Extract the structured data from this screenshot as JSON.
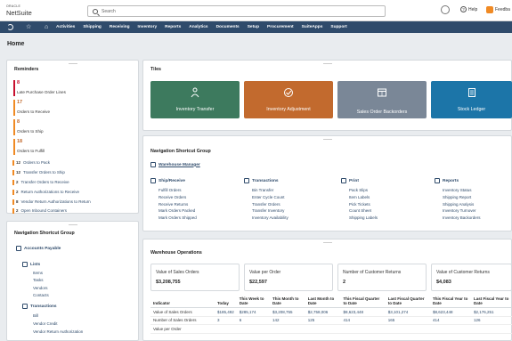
{
  "brand": {
    "oracle": "ORACLE",
    "netsuite": "NetSuite"
  },
  "search": {
    "placeholder": "Search"
  },
  "header": {
    "help": "Help",
    "user": "Feedba"
  },
  "nav": [
    "Activities",
    "Shipping",
    "Receiving",
    "Inventory",
    "Reports",
    "Analytics",
    "Documents",
    "Setup",
    "Procurement",
    "SuiteApps",
    "Support"
  ],
  "page_title": "Home",
  "reminders": {
    "title": "Reminders",
    "counts": [
      {
        "n": "8",
        "label": "Late Purchase Order Lines"
      },
      {
        "n": "17",
        "label": "Orders to Receive"
      },
      {
        "n": "8",
        "label": "Orders to Ship"
      },
      {
        "n": "18",
        "label": "Orders to Fulfill"
      }
    ],
    "small": [
      {
        "n": "12",
        "label": "Orders to Pack"
      },
      {
        "n": "12",
        "label": "Transfer Orders to Ship"
      },
      {
        "n": "2",
        "label": "Transfer Orders to Receive"
      },
      {
        "n": "2",
        "label": "Return Authorizations to Receive"
      },
      {
        "n": "8",
        "label": "Vendor Return Authorizations to Return"
      },
      {
        "n": "2",
        "label": "Open Inbound Containers"
      }
    ]
  },
  "left_shortcuts": {
    "title": "Navigation Shortcut Group",
    "group": "Accounts Payable",
    "lists": "Lists",
    "list_items": [
      "Items",
      "Tasks",
      "Vendors",
      "Contacts"
    ],
    "transactions": "Transactions",
    "transaction_items": [
      "Bill",
      "Vendor Credit",
      "Vendor Return Authorization"
    ]
  },
  "tiles": {
    "title": "Tiles",
    "items": [
      {
        "label": "Inventory Transfer",
        "color": "#3d7a5e",
        "icon": "people-transfer-icon"
      },
      {
        "label": "Inventory Adjustment",
        "color": "#c26a2e",
        "icon": "adjustment-check-icon"
      },
      {
        "label": "Sales Order Backorders",
        "color": "#7a8797",
        "icon": "calendar-grid-icon"
      },
      {
        "label": "Stock Ledger",
        "color": "#1c75a8",
        "icon": "ledger-icon"
      }
    ]
  },
  "center_shortcuts": {
    "title": "Navigation Shortcut Group",
    "group": "Warehouse Manager",
    "columns": [
      {
        "head": "Ship/Receive",
        "items": [
          "Fulfill Orders",
          "Receive Orders",
          "Receive Returns",
          "Mark Orders Packed",
          "Mark Orders Shipped"
        ]
      },
      {
        "head": "Transactions",
        "items": [
          "Bin Transfer",
          "Enter Cycle Count",
          "Transfer Orders",
          "Transfer Inventory",
          "Inventory Availability"
        ]
      },
      {
        "head": "Print",
        "items": [
          "Pack Slips",
          "Item Labels",
          "Pick Tickets",
          "Count Sheet",
          "Shipping Labels"
        ]
      },
      {
        "head": "Reports",
        "items": [
          "Inventory Status",
          "Shipping Report",
          "Shipping Analysis",
          "Inventory Turnover",
          "Inventory Backorders"
        ]
      }
    ]
  },
  "warehouse_ops": {
    "title": "Warehouse Operations",
    "kpis": [
      {
        "label": "Value of Sales Orders",
        "value": "$3,208,755"
      },
      {
        "label": "Value per Order",
        "value": "$22,597"
      },
      {
        "label": "Number of Customer Returns",
        "value": "2"
      },
      {
        "label": "Value of Customer Returns",
        "value": "$4,083"
      }
    ],
    "table": {
      "headers": [
        "Indicator",
        "Today",
        "This Week to Date",
        "This Month to Date",
        "Last Month to Date",
        "This Fiscal Quarter to Date",
        "Last Fiscal Quarter to Date",
        "This Fiscal Year to Date",
        "Last Fiscal Year to Date"
      ],
      "rows": [
        [
          "Value of Sales Orders",
          "$185,492",
          "$285,174",
          "$3,208,755",
          "$2,758,006",
          "$8,623,448",
          "$3,101,274",
          "$8,623,448",
          "$2,176,251"
        ],
        [
          "Number of Sales Orders",
          "3",
          "6",
          "142",
          "125",
          "414",
          "165",
          "414",
          "126"
        ],
        [
          "Value per Order",
          "",
          "",
          "",
          "",
          "",
          "",
          "",
          ""
        ]
      ]
    }
  }
}
